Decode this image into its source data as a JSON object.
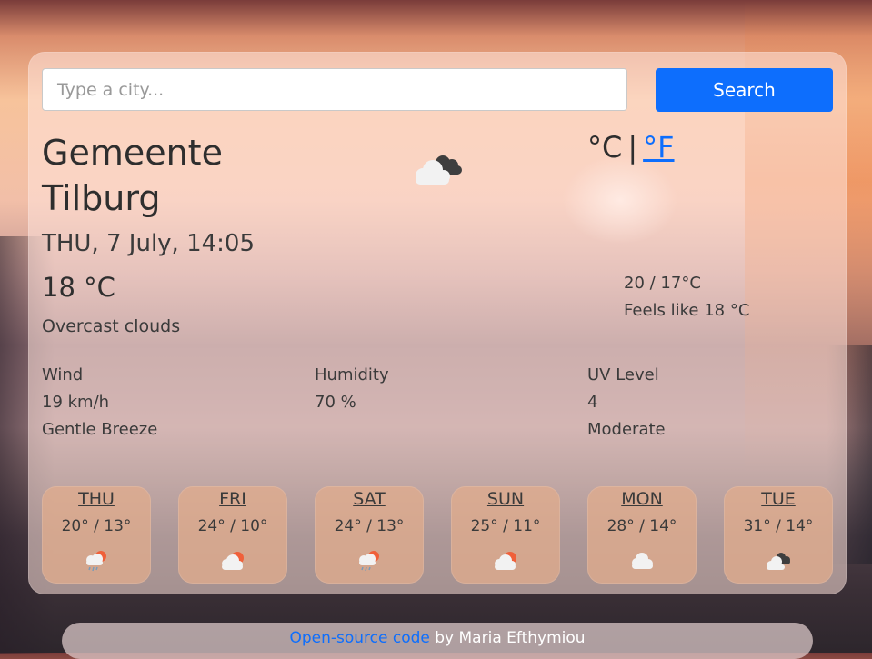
{
  "search": {
    "placeholder": "Type a city...",
    "button_label": "Search"
  },
  "current": {
    "city": "Gemeente Tilburg",
    "icon": "overcast-clouds-icon",
    "unit_c": "°C",
    "unit_separator": "|",
    "unit_f": "°F",
    "datetime": "THU, 7 July, 14:05",
    "temperature": "18 °C",
    "description": "Overcast clouds",
    "min_max": "20 / 17°C",
    "feels_like": "Feels like 18 °C"
  },
  "stats": {
    "wind": {
      "label": "Wind",
      "value": "19 km/h",
      "detail": "Gentle Breeze"
    },
    "humidity": {
      "label": "Humidity",
      "value": "70 %"
    },
    "uv": {
      "label": "UV Level",
      "value": "4",
      "detail": "Moderate"
    }
  },
  "forecast": [
    {
      "day": "THU",
      "range": "20° / 13°",
      "icon": "rain-sun-icon"
    },
    {
      "day": "FRI",
      "range": "24° / 10°",
      "icon": "partly-cloudy-icon"
    },
    {
      "day": "SAT",
      "range": "24° / 13°",
      "icon": "rain-sun-icon"
    },
    {
      "day": "SUN",
      "range": "25° / 11°",
      "icon": "partly-cloudy-icon"
    },
    {
      "day": "MON",
      "range": "28° / 14°",
      "icon": "cloud-icon"
    },
    {
      "day": "TUE",
      "range": "31° / 14°",
      "icon": "overcast-clouds-icon"
    }
  ],
  "footer": {
    "link_text": "Open-source code",
    "author_text": " by Maria Efthymiou"
  },
  "colors": {
    "accent": "#0d6efd",
    "sun": "#f0603a",
    "cloud_dark": "#3e3e3e",
    "rain": "#7a9bb8"
  }
}
